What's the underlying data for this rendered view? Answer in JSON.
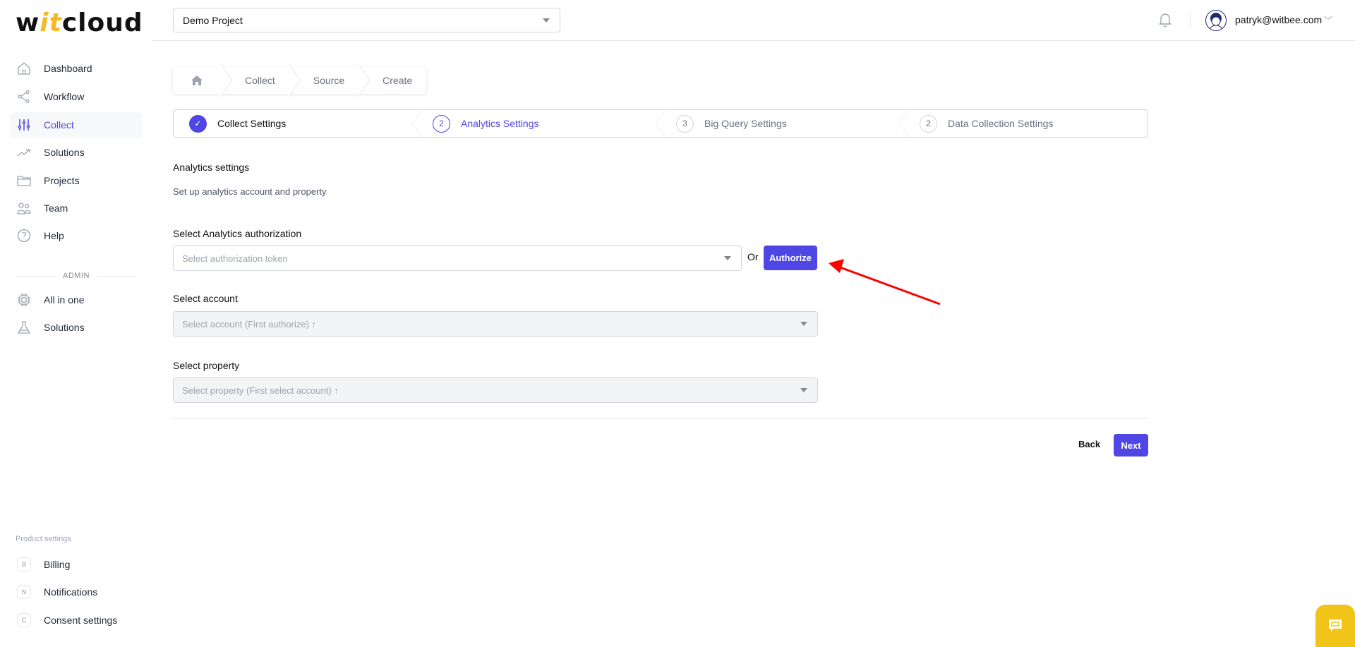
{
  "brand": {
    "logo_pre": "w",
    "logo_it": "it",
    "logo_post": "cloud"
  },
  "header": {
    "project": "Demo Project",
    "user_email": "patryk@witbee.com"
  },
  "sidebar": {
    "items": [
      {
        "label": "Dashboard",
        "icon": "home-icon"
      },
      {
        "label": "Workflow",
        "icon": "share-icon"
      },
      {
        "label": "Collect",
        "icon": "sliders-icon",
        "active": true
      },
      {
        "label": "Solutions",
        "icon": "trending-icon"
      },
      {
        "label": "Projects",
        "icon": "folder-icon"
      },
      {
        "label": "Team",
        "icon": "users-icon"
      },
      {
        "label": "Help",
        "icon": "help-icon"
      }
    ],
    "admin_label": "ADMIN",
    "admin_items": [
      {
        "label": "All in one",
        "icon": "chip-icon"
      },
      {
        "label": "Solutions",
        "icon": "flask-icon"
      }
    ],
    "product_settings_label": "Product settings",
    "product_items": [
      {
        "letter": "B",
        "label": "Billing"
      },
      {
        "letter": "N",
        "label": "Notifications"
      },
      {
        "letter": "C",
        "label": "Consent settings"
      }
    ]
  },
  "breadcrumb": [
    "Collect",
    "Source",
    "Create"
  ],
  "steps": [
    {
      "num": "✓",
      "label": "Collect Settings",
      "state": "done"
    },
    {
      "num": "2",
      "label": "Analytics Settings",
      "state": "current"
    },
    {
      "num": "3",
      "label": "Big Query Settings",
      "state": "pending"
    },
    {
      "num": "2",
      "label": "Data Collection Settings",
      "state": "pending"
    }
  ],
  "form": {
    "title": "Analytics settings",
    "subtitle": "Set up analytics account and property",
    "auth_label": "Select Analytics authorization",
    "auth_placeholder": "Select authorization token",
    "or": "Or",
    "authorize": "Authorize",
    "account_label": "Select account",
    "account_placeholder": "Select account (First authorize) ↑",
    "property_label": "Select property",
    "property_placeholder": "Select property (First select account) ↑",
    "back": "Back",
    "next": "Next"
  },
  "colors": {
    "accent": "#4f46e5",
    "annotation": "#ff0000",
    "chat": "#f0c419"
  }
}
